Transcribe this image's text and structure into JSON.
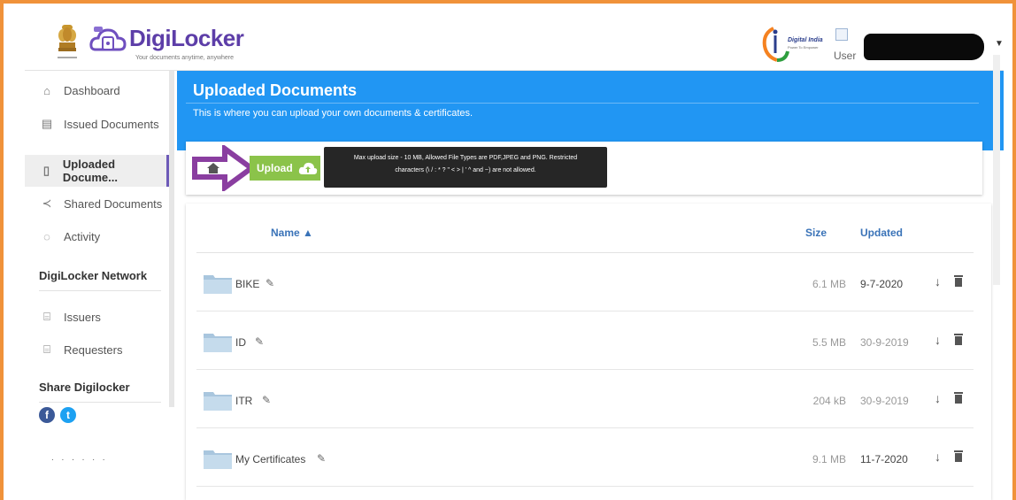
{
  "header": {
    "brand": "DigiLocker",
    "tagline": "Your documents anytime, anywhere",
    "partner_text": "Digital India",
    "partner_sub": "Power To Empower",
    "user_label": "User"
  },
  "sidebar": {
    "items": [
      {
        "label": "Dashboard",
        "icon": "home-outline-icon"
      },
      {
        "label": "Issued Documents",
        "icon": "certificate-icon"
      },
      {
        "label": "Uploaded Docume...",
        "icon": "upload-doc-icon"
      },
      {
        "label": "Shared Documents",
        "icon": "share-icon"
      },
      {
        "label": "Activity",
        "icon": "activity-icon"
      }
    ],
    "network_heading": "DigiLocker Network",
    "network_items": [
      {
        "label": "Issuers",
        "icon": "building-icon"
      },
      {
        "label": "Requesters",
        "icon": "building-people-icon"
      }
    ],
    "share_heading": "Share Digilocker",
    "share_icons": [
      "facebook-icon",
      "twitter-icon"
    ],
    "facebook_glyph": "f",
    "twitter_glyph": "t"
  },
  "banner": {
    "title": "Uploaded Documents",
    "subtitle": "This is where you can upload your own documents & certificates."
  },
  "upload": {
    "button_label": "Upload",
    "tooltip_line1": "Max upload size - 10 MB, Allowed File Types are PDF,JPEG and PNG. Restricted",
    "tooltip_line2": "characters (\\ / : * ? \" < > | ' ^ and ~) are not allowed."
  },
  "table": {
    "columns": {
      "name": "Name ▲",
      "size": "Size",
      "updated": "Updated"
    },
    "rows": [
      {
        "name": "BIKE",
        "size": "6.1 MB",
        "updated": "9-7-2020"
      },
      {
        "name": "ID",
        "size": "5.5 MB",
        "updated": "30-9-2019"
      },
      {
        "name": "ITR",
        "size": "204 kB",
        "updated": "30-9-2019"
      },
      {
        "name": "My Certificates",
        "size": "9.1 MB",
        "updated": "11-7-2020"
      }
    ]
  },
  "colors": {
    "frame": "#f0923a",
    "brand": "#5d3ea8",
    "banner": "#2196f3",
    "upload_button": "#8bc34a",
    "annotation_arrow": "#8a3ea0",
    "header_link": "#3a73b8"
  }
}
